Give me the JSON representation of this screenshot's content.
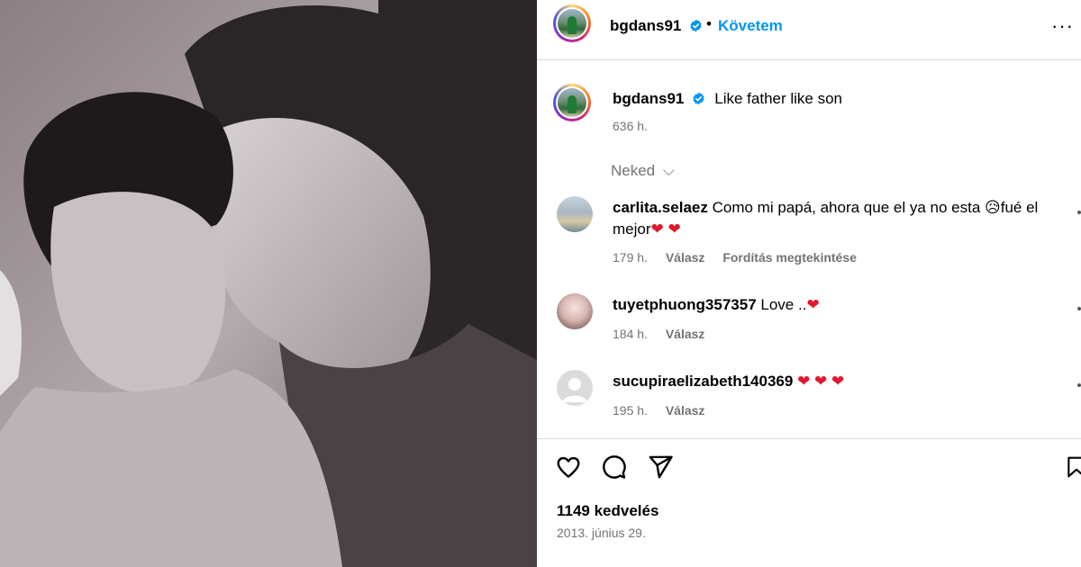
{
  "post": {
    "author": "bgdans91",
    "follow_label": "Követem",
    "separator": "•",
    "more_label": "···",
    "caption": "Like father like son",
    "caption_age": "636 h.",
    "likes": "1149 kedvelés",
    "date": "2013. június 29."
  },
  "comments_filter": {
    "label": "Neked",
    "chevron": "⌵"
  },
  "comments": [
    {
      "user": "carlita.selaez",
      "text": "Como mi papá, ahora que el ya no esta 😥fué el mejor",
      "hearts": "❤ ❤",
      "age": "179 h.",
      "reply": "Válasz",
      "translate": "Fordítás megtekintése"
    },
    {
      "user": "tuyetphuong357357",
      "text": "Love ..",
      "hearts": "❤",
      "age": "184 h.",
      "reply": "Válasz"
    },
    {
      "user": "sucupiraelizabeth140369",
      "text": "",
      "hearts": "❤ ❤ ❤",
      "age": "195 h.",
      "reply": "Válasz"
    }
  ],
  "icons": {
    "like": "heart-outline-icon",
    "comment": "comment-bubble-icon",
    "share": "paper-plane-icon",
    "save": "bookmark-icon",
    "verified": "verified-badge-icon"
  },
  "colors": {
    "accent": "#0095f6",
    "heart": "#e0182d",
    "muted": "#737373"
  }
}
